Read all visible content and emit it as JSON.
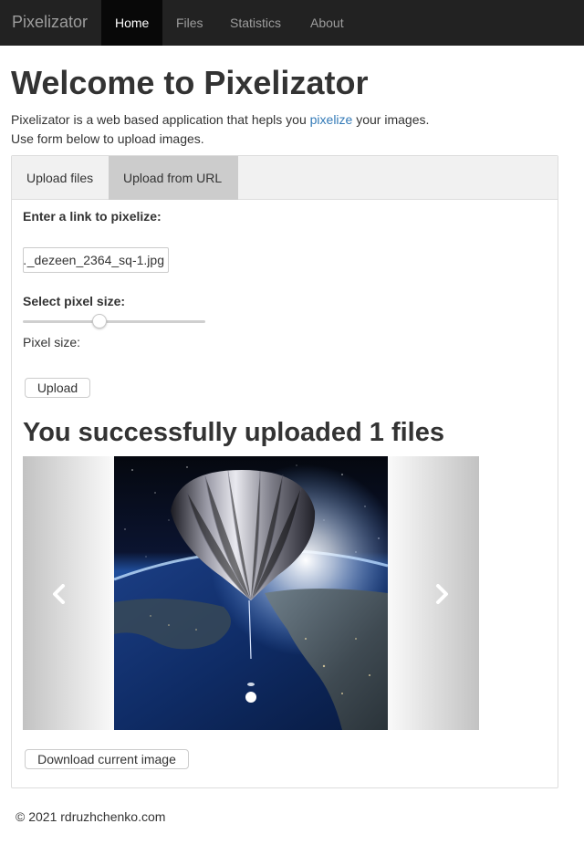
{
  "navbar": {
    "brand": "Pixelizator",
    "items": [
      {
        "label": "Home",
        "active": true
      },
      {
        "label": "Files",
        "active": false
      },
      {
        "label": "Statistics",
        "active": false
      },
      {
        "label": "About",
        "active": false
      }
    ]
  },
  "header": {
    "title": "Welcome to Pixelizator",
    "intro_before": "Pixelizator is a web based application that hepls you ",
    "intro_link": "pixelize",
    "intro_after": " your images.",
    "intro_line2": "Use form below to upload images."
  },
  "tabs": [
    {
      "label": "Upload files",
      "active": false
    },
    {
      "label": "Upload from URL",
      "active": true
    }
  ],
  "form": {
    "link_label": "Enter a link to pixelize:",
    "url_value": "…_dezeen_2364_sq-1.jpg",
    "pixel_label": "Select pixel size:",
    "slider_fraction": 0.42,
    "pixel_size_text": "Pixel size:",
    "upload_label": "Upload"
  },
  "result": {
    "success_text": "You successfully uploaded 1 files",
    "carousel_prev_icon": "chevron-left-icon",
    "carousel_next_icon": "chevron-right-icon",
    "slide_count": 1,
    "download_label": "Download current image"
  },
  "footer": {
    "text": "© 2021 rdruzhchenko.com"
  },
  "colors": {
    "navbar_bg": "#222222",
    "nav_active_bg": "#080808",
    "link": "#337ab7",
    "active_tab_bg": "#cccccc",
    "tabbar_bg": "#f1f1f1"
  }
}
